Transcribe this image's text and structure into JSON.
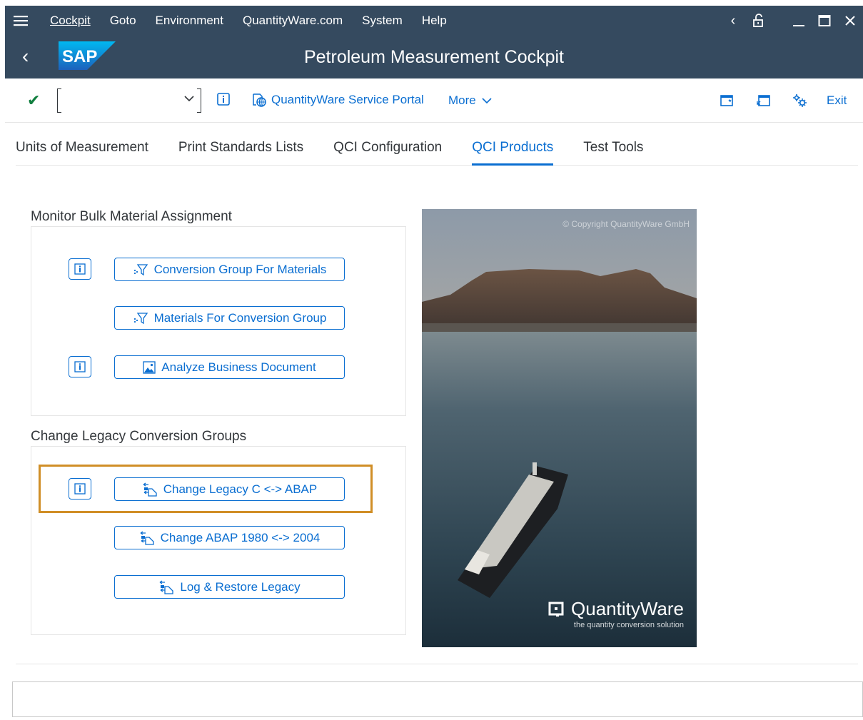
{
  "menubar": {
    "items": [
      "Cockpit",
      "Goto",
      "Environment",
      "QuantityWare.com",
      "System",
      "Help"
    ],
    "icons": [
      "hamburger-icon",
      "chevron-left-icon",
      "unlock-icon",
      "minimize-icon",
      "maximize-icon",
      "close-icon"
    ]
  },
  "titlebar": {
    "title": "Petroleum Measurement Cockpit",
    "logo_text": "SAP"
  },
  "toolbar": {
    "command_value": "",
    "portal_label": "QuantityWare Service Portal",
    "more_label": "More",
    "exit_label": "Exit"
  },
  "tabs": [
    {
      "label": "Units of Measurement",
      "active": false
    },
    {
      "label": "Print Standards Lists",
      "active": false
    },
    {
      "label": "QCI Configuration",
      "active": false
    },
    {
      "label": "QCI Products",
      "active": true
    },
    {
      "label": "Test Tools",
      "active": false
    }
  ],
  "sections": {
    "monitor": {
      "title": "Monitor Bulk Material Assignment",
      "buttons": [
        "Conversion Group For Materials",
        "Materials For Conversion Group",
        "Analyze Business Document"
      ]
    },
    "legacy": {
      "title": "Change Legacy Conversion Groups",
      "buttons": [
        "Change Legacy C <-> ABAP",
        "Change ABAP 1980 <-> 2004",
        "Log & Restore Legacy"
      ]
    }
  },
  "image": {
    "copyright": "© Copyright QuantityWare GmbH",
    "brand": "QuantityWare",
    "tagline": "the quantity conversion solution"
  },
  "colors": {
    "shell": "#354a5f",
    "accent": "#0a6ed1",
    "highlight": "#d08e26",
    "ok": "#107e3e"
  }
}
